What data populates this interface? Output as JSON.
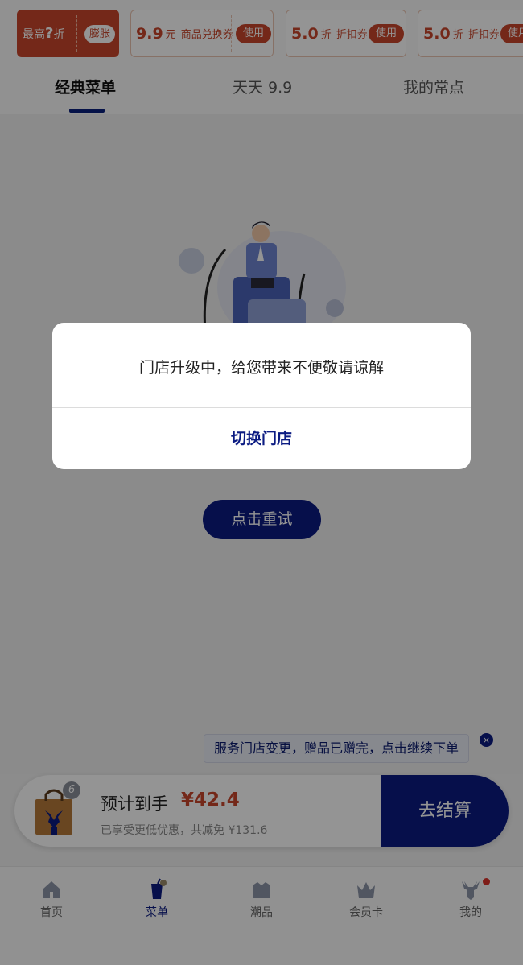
{
  "coupons": [
    {
      "kind": "primary",
      "text_a": "最高",
      "text_q": "?",
      "text_b": "折",
      "pill": "膨胀"
    },
    {
      "amount": "9.9",
      "unit": "元",
      "desc": "商品兑换券",
      "action": "使用"
    },
    {
      "amount": "5.0",
      "unit": "折",
      "desc": "折扣券",
      "action": "使用"
    },
    {
      "amount": "5.0",
      "unit": "折",
      "desc": "折扣券",
      "action": "使用"
    }
  ],
  "tabs": [
    {
      "label": "经典菜单",
      "active": true
    },
    {
      "label": "天天 9.9",
      "active": false
    },
    {
      "label": "我的常点",
      "active": false
    }
  ],
  "content": {
    "retry_label": "点击重试"
  },
  "toast": {
    "message": "服务门店变更，赠品已赠完，点击继续下单",
    "close_glyph": "×"
  },
  "checkout": {
    "badge_count": "6",
    "estimate_label": "预计到手",
    "estimate_price": "¥42.4",
    "saving_text": "已享受更低优惠，共减免 ¥131.6",
    "pay_label": "去结算"
  },
  "nav": [
    {
      "label": "首页",
      "icon": "home-icon"
    },
    {
      "label": "菜单",
      "icon": "drink-cup-icon",
      "active": true
    },
    {
      "label": "潮品",
      "icon": "bag-icon"
    },
    {
      "label": "会员卡",
      "icon": "crown-icon"
    },
    {
      "label": "我的",
      "icon": "deer-icon",
      "dot": true
    }
  ],
  "modal": {
    "message": "门店升级中，给您带来不便敬请谅解",
    "action_label": "切换门店"
  },
  "colors": {
    "brand_blue": "#0b1b82",
    "coupon_red": "#c8462b",
    "overlay": "rgba(0,0,0,0.42)"
  }
}
